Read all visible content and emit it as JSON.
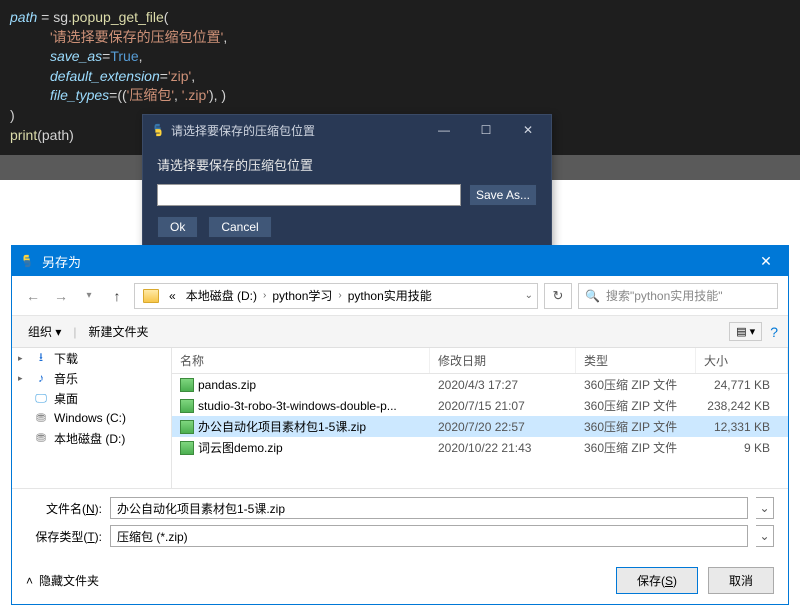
{
  "code": {
    "l1_a": "path",
    "l1_b": " = sg.",
    "l1_c": "popup_get_file",
    "l1_d": "(",
    "l2": "'请选择要保存的压缩包位置'",
    "l3_a": "save_as",
    "l3_b": "=",
    "l3_c": "True",
    "l4_a": "default_extension",
    "l4_b": "=",
    "l4_c": "'zip'",
    "l5_a": "file_types",
    "l5_b": "=((",
    "l5_c": "'压缩包'",
    "l5_d": ", ",
    "l5_e": "'.zip'",
    "l5_f": "), )",
    "l6": ")",
    "l7_a": "print",
    "l7_b": "(path)"
  },
  "popup": {
    "title": "请选择要保存的压缩包位置",
    "label": "请选择要保存的压缩包位置",
    "saveas": "Save As...",
    "ok": "Ok",
    "cancel": "Cancel"
  },
  "dialog": {
    "title": "另存为",
    "breadcrumb": {
      "prefix": "«",
      "seg1": "本地磁盘 (D:)",
      "seg2": "python学习",
      "seg3": "python实用技能"
    },
    "search_placeholder": "搜索\"python实用技能\"",
    "toolbar": {
      "organize": "组织 ▾",
      "newfolder": "新建文件夹"
    },
    "sidebar": {
      "downloads": "下载",
      "music": "音乐",
      "desktop": "桌面",
      "c": "Windows (C:)",
      "d": "本地磁盘 (D:)"
    },
    "columns": {
      "name": "名称",
      "date": "修改日期",
      "type": "类型",
      "size": "大小"
    },
    "rows": [
      {
        "name": "pandas.zip",
        "date": "2020/4/3 17:27",
        "type": "360压缩 ZIP 文件",
        "size": "24,771 KB",
        "selected": false
      },
      {
        "name": "studio-3t-robo-3t-windows-double-p...",
        "date": "2020/7/15 21:07",
        "type": "360压缩 ZIP 文件",
        "size": "238,242 KB",
        "selected": false
      },
      {
        "name": "办公自动化项目素材包1-5课.zip",
        "date": "2020/7/20 22:57",
        "type": "360压缩 ZIP 文件",
        "size": "12,331 KB",
        "selected": true
      },
      {
        "name": "词云图demo.zip",
        "date": "2020/10/22 21:43",
        "type": "360压缩 ZIP 文件",
        "size": "9 KB",
        "selected": false
      }
    ],
    "filename_label_a": "文件名(",
    "filename_label_u": "N",
    "filename_label_b": "):",
    "filetype_label_a": "保存类型(",
    "filetype_label_u": "T",
    "filetype_label_b": "):",
    "filename_value": "办公自动化项目素材包1-5课.zip",
    "filetype_value": "压缩包 (*.zip)",
    "hide_folders": "隐藏文件夹",
    "save_btn_a": "保存(",
    "save_btn_u": "S",
    "save_btn_b": ")",
    "cancel_btn": "取消"
  }
}
